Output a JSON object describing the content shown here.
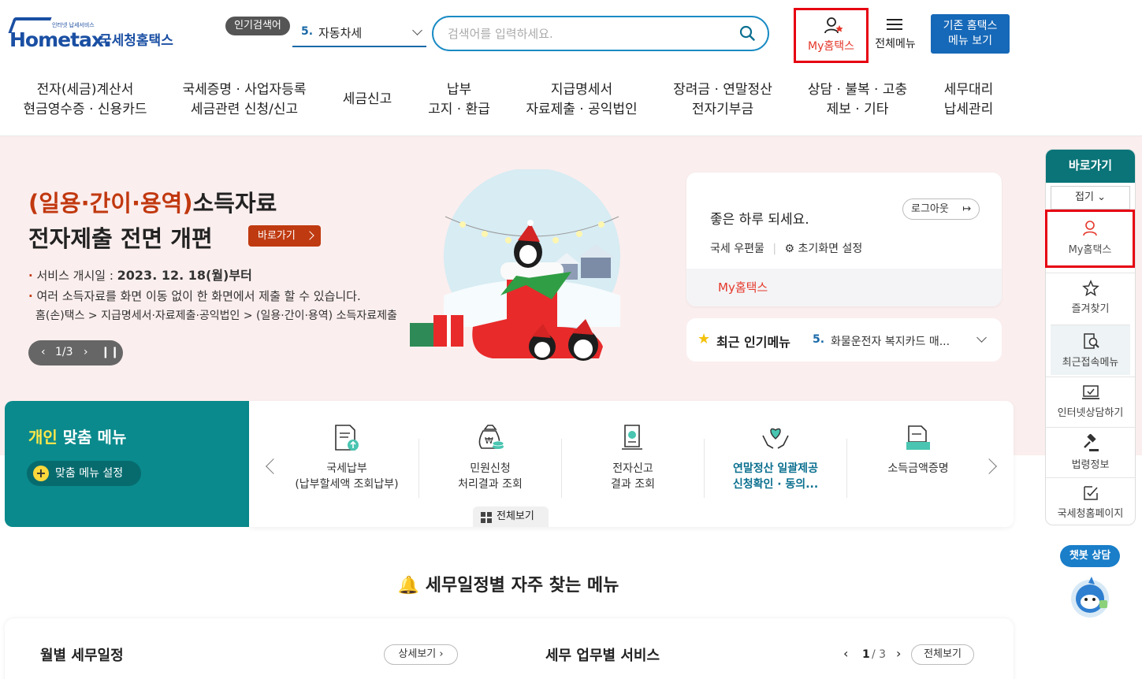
{
  "header": {
    "logo_small": "인터넷 납세서비스",
    "logo_main": "Hometax.",
    "logo_name": "국세청홈택스",
    "popular_badge": "인기검색어",
    "popular_num": "5.",
    "popular_text": "자동차세",
    "search_placeholder": "검색어를 입력하세요.",
    "myhometax_label": "My홈택스",
    "allmenu_label": "전체메뉴",
    "legacy_line1": "기존 홈택스",
    "legacy_line2": "메뉴 보기"
  },
  "nav": [
    {
      "line1": "전자(세금)계산서",
      "line2": "현금영수증 · 신용카드"
    },
    {
      "line1": "국세증명 · 사업자등록",
      "line2": "세금관련 신청/신고"
    },
    {
      "line1": "세금신고",
      "line2": ""
    },
    {
      "line1": "납부",
      "line2": "고지 · 환급"
    },
    {
      "line1": "지급명세서",
      "line2": "자료제출 · 공익법인"
    },
    {
      "line1": "장려금 · 연말정산",
      "line2": "전자기부금"
    },
    {
      "line1": "상담 · 불복 · 고충",
      "line2": "제보 · 기타"
    },
    {
      "line1": "세무대리",
      "line2": "납세관리"
    }
  ],
  "banner": {
    "title1_highlight": "(일용·간이·용역)",
    "title1_rest": "소득자료",
    "title2": "전자제출 전면 개편",
    "go_label": "바로가기",
    "line1_label": "서비스 개시일 :",
    "line1_value": "2023. 12. 18(월)부터",
    "line2": "여러 소득자료를 화면 이동 없이 한 화면에서 제출 할 수 있습니다.",
    "line3": "홈(손)택스 > 지급명세서·자료제출·공익법인 > (일용·간이·용역) 소득자료제출",
    "page": "1/3"
  },
  "login": {
    "greeting": "좋은 하루 되세요.",
    "logout": "로그아웃",
    "mall": "국세 우편물",
    "settings": "초기화면 설정",
    "myhometax": "My홈택스"
  },
  "recent": {
    "title": "최근 인기메뉴",
    "num": "5.",
    "text": "화물운전자 복지카드 매..."
  },
  "personal": {
    "title_hl": "개인",
    "title_rest": " 맞춤 메뉴",
    "setting": "맞춤 메뉴 설정",
    "items": [
      {
        "line1": "국세납부",
        "line2": "(납부할세액 조회납부)"
      },
      {
        "line1": "민원신청",
        "line2": "처리결과 조회"
      },
      {
        "line1": "전자신고",
        "line2": "결과 조회"
      },
      {
        "line1": "연말정산 일괄제공",
        "line2": "신청확인 · 동의..."
      },
      {
        "line1": "소득금액증명",
        "line2": ""
      }
    ],
    "view_all": "전체보기"
  },
  "calendar": {
    "title": "세무일정별 자주 찾는 메뉴",
    "monthly": "월별 세무일정",
    "detail": "상세보기",
    "service": "세무 업무별 서비스",
    "page_cur": "1",
    "page_total": "/ 3",
    "view_all": "전체보기"
  },
  "quick": {
    "title": "바로가기",
    "fold": "접기",
    "items": [
      "My홈택스",
      "즐겨찾기",
      "최근접속메뉴",
      "인터넷상담하기",
      "법령정보",
      "국세청홈페이지"
    ]
  },
  "chatbot": {
    "label": "챗봇 상담"
  },
  "colors": {
    "brand": "#1a4fa3",
    "teal": "#0a8a8c",
    "accent_red": "#c1380f",
    "highlight_box": "#e60012"
  }
}
